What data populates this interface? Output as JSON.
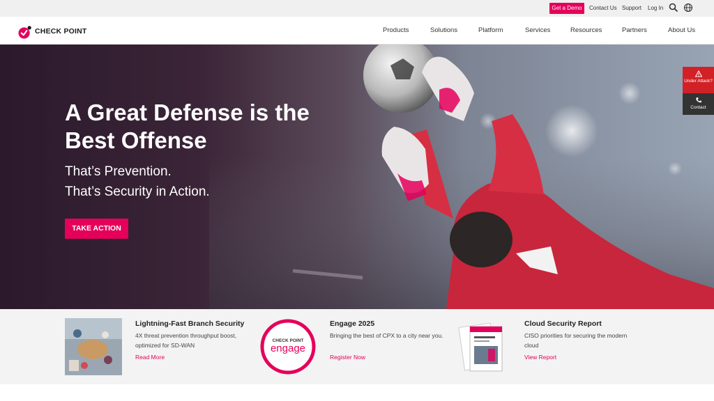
{
  "utility": {
    "demo_label": "Get a Demo",
    "links": [
      "Contact Us",
      "Support",
      "Log In"
    ],
    "icons": [
      "search-icon",
      "globe-icon"
    ]
  },
  "nav": {
    "logo_text": "CHECK POINT",
    "items": [
      "Products",
      "Solutions",
      "Platform",
      "Services",
      "Resources",
      "Partners",
      "About Us"
    ]
  },
  "hero": {
    "title": "A Great Defense is the Best Offense",
    "sub1": "That’s Prevention.",
    "sub2": "That’s Security in Action.",
    "cta": "TAKE ACTION"
  },
  "side_widget": {
    "attack_label": "Under Attack?",
    "contact_label": "Contact"
  },
  "promos": [
    {
      "title": "Lightning-Fast Branch Security",
      "desc": "4X threat prevention throughput boost, optimized for SD-WAN",
      "link": "Read More"
    },
    {
      "title": "Engage 2025",
      "desc": "Bringing the best of CPX to a city near you.",
      "link": "Register Now",
      "badge_top": "CHECK POINT",
      "badge_word": "engage"
    },
    {
      "title": "Cloud Security Report",
      "desc": "CISO priorities for securing the modern cloud",
      "link": "View Report"
    }
  ],
  "colors": {
    "brand": "#e5005a",
    "alert": "#d12127"
  }
}
